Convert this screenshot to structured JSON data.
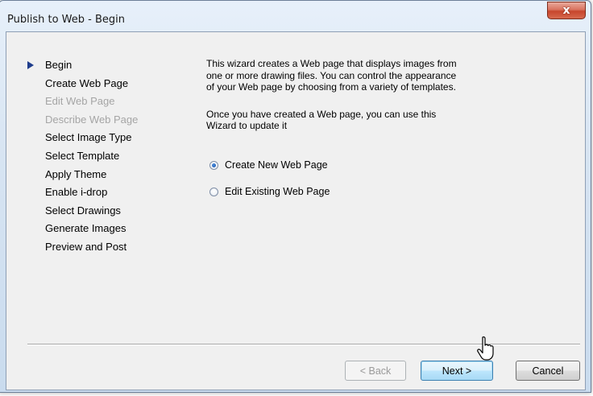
{
  "window": {
    "title": "Publish to Web - Begin",
    "close_glyph": "x"
  },
  "steps": [
    {
      "label": "Begin",
      "state": "current"
    },
    {
      "label": "Create Web Page",
      "state": "enabled"
    },
    {
      "label": "Edit Web Page",
      "state": "disabled"
    },
    {
      "label": "Describe Web Page",
      "state": "disabled"
    },
    {
      "label": "Select Image Type",
      "state": "enabled"
    },
    {
      "label": "Select Template",
      "state": "enabled"
    },
    {
      "label": "Apply Theme",
      "state": "enabled"
    },
    {
      "label": "Enable i-drop",
      "state": "enabled"
    },
    {
      "label": "Select Drawings",
      "state": "enabled"
    },
    {
      "label": "Generate Images",
      "state": "enabled"
    },
    {
      "label": "Preview and Post",
      "state": "enabled"
    }
  ],
  "content": {
    "intro": "This wizard creates a Web page that displays images from\none or more drawing files.  You can control the appearance\nof your Web page by choosing from a variety of templates.",
    "note": "Once you have created a Web page, you can use this\nWizard to update it",
    "options": [
      {
        "label": "Create New Web Page",
        "checked": true
      },
      {
        "label": "Edit Existing Web Page",
        "checked": false
      }
    ]
  },
  "buttons": {
    "back": "< Back",
    "next": "Next >",
    "cancel": "Cancel"
  },
  "icons": {
    "current_step": "arrow-right-icon",
    "cursor": "mouse-pointer-icon"
  },
  "colors": {
    "accent": "#1f3d8c",
    "disabled_text": "#a5a5a5",
    "close": "#c7452c"
  }
}
